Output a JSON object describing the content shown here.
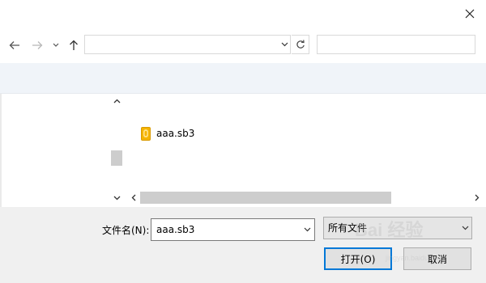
{
  "titlebar": {
    "close_icon": "close-icon"
  },
  "nav": {
    "back_icon": "arrow-left-icon",
    "forward_icon": "arrow-right-icon",
    "recent_icon": "chevron-down-icon",
    "up_icon": "arrow-up-icon",
    "address_value": "",
    "search_value": ""
  },
  "files": [
    {
      "name": "aaa.sb3",
      "icon": "sb3-file-icon"
    }
  ],
  "bottom": {
    "filename_label": "文件名(N):",
    "filename_value": "aaa.sb3",
    "filetype_value": "所有文件",
    "open_label": "打开(O)",
    "cancel_label": "取消"
  },
  "watermark": {
    "text": "Bai 经验",
    "sub": "jingyan.baidu.com"
  },
  "colors": {
    "accent": "#0078d7",
    "command_bar": "#f0f4f9",
    "bottom_panel": "#f0f0f0",
    "file_icon": "#f5b400",
    "scroll_thumb": "#cdcdcd"
  }
}
